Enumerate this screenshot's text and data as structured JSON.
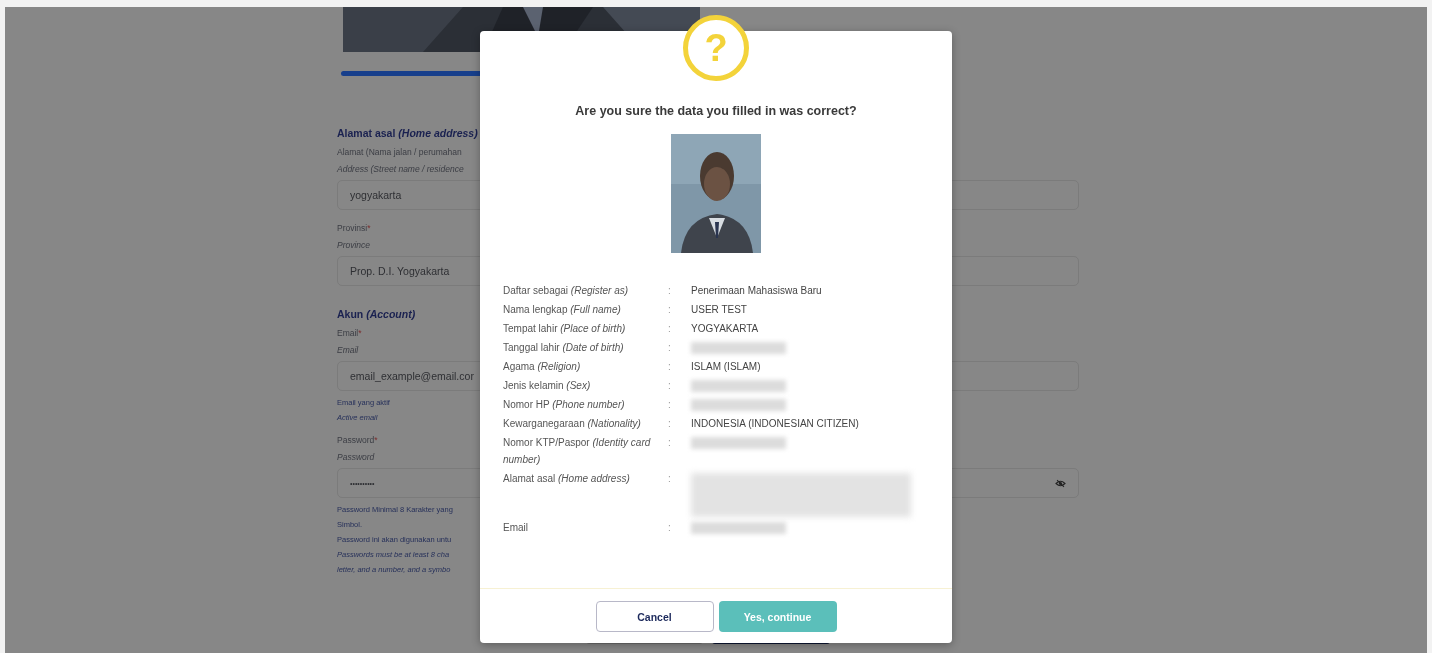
{
  "form": {
    "sections": [
      {
        "heading": "Alamat asal *(Home address)*",
        "fields": [
          {
            "label": "Alamat (Nama jalan / perumahan",
            "sublabel": "Address (Street name / residence",
            "value": "yogyakarta",
            "kind": "text"
          },
          {
            "label": "Provinsi",
            "required_mark": "*",
            "sublabel": "Province",
            "value": "Prop. D.I. Yogyakarta",
            "kind": "text"
          }
        ]
      },
      {
        "heading": "Akun *(Account)*",
        "fields": [
          {
            "label": "Email",
            "required_mark": "*",
            "sublabel": "Email",
            "value": "email_example@email.cor",
            "kind": "text",
            "hints": [
              {
                "text": "Email yang aktif",
                "italic": false
              },
              {
                "text": "Active email",
                "italic": true
              }
            ]
          },
          {
            "label": "Password",
            "required_mark": "*",
            "sublabel": "Password",
            "value": "••••••••••",
            "kind": "password",
            "hints": [
              {
                "text": "Password Minimal 8 Karakter yang",
                "italic": false
              },
              {
                "text": "Simbol.",
                "italic": false
              },
              {
                "text": "Password ini akan digunakan untu",
                "italic": false
              },
              {
                "text": "Passwords must be at least 8 cha",
                "italic": true
              },
              {
                "text": "letter, and a number, and a symbo",
                "italic": true
              }
            ]
          }
        ]
      }
    ]
  },
  "dialog": {
    "icon": "?",
    "title": "Are you sure the data you filled in was correct?",
    "rows": [
      {
        "label": "Daftar sebagai *(Register as)*",
        "separator": ":",
        "kind": "text",
        "value": "Penerimaan Mahasiswa Baru"
      },
      {
        "label": "Nama lengkap *(Full name)*",
        "separator": ":",
        "kind": "text",
        "value": "USER TEST"
      },
      {
        "label": "Tempat lahir *(Place of birth)*",
        "separator": ":",
        "kind": "text",
        "value": "YOGYAKARTA"
      },
      {
        "label": "Tanggal lahir *(Date of birth)*",
        "separator": ":",
        "kind": "redacted"
      },
      {
        "label": "Agama *(Religion)*",
        "separator": ":",
        "kind": "text",
        "value": "ISLAM (ISLAM)"
      },
      {
        "label": "Jenis kelamin *(Sex)*",
        "separator": ":",
        "kind": "redacted"
      },
      {
        "label": "Nomor HP *(Phone number)*",
        "separator": ":",
        "kind": "redacted"
      },
      {
        "label": "Kewarganegaraan *(Nationality)*",
        "separator": ":",
        "kind": "text",
        "value": "INDONESIA (INDONESIAN CITIZEN)"
      },
      {
        "label": "Nomor KTP/Paspor *(Identity card number)*",
        "separator": ":",
        "kind": "redacted"
      },
      {
        "label": "Alamat asal *(Home address)*",
        "separator": ":",
        "kind": "redacted_block"
      },
      {
        "label": "Email",
        "separator": ":",
        "kind": "redacted"
      }
    ],
    "buttons": [
      {
        "label": "Cancel",
        "kind": "secondary"
      },
      {
        "label": "Yes, continue",
        "kind": "primary"
      }
    ]
  }
}
